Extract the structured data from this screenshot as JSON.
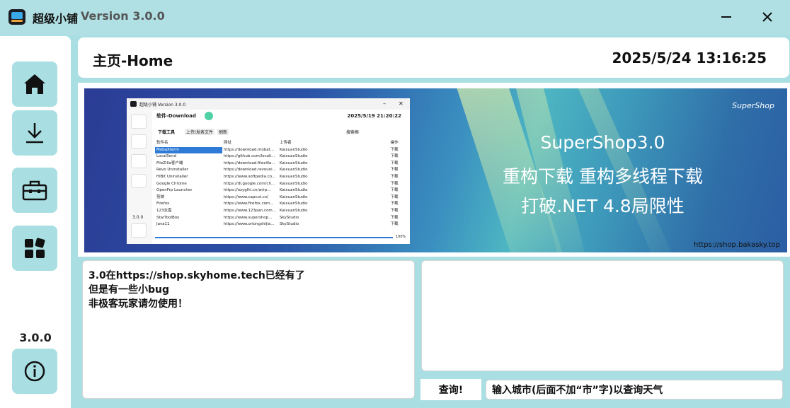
{
  "window": {
    "title": "超级小铺",
    "version": "Version 3.0.0"
  },
  "sidebar": {
    "items": [
      {
        "icon": "home-icon"
      },
      {
        "icon": "download-icon"
      },
      {
        "icon": "toolbox-icon"
      },
      {
        "icon": "apps-icon"
      }
    ],
    "version": "3.0.0",
    "about_icon": "info-icon"
  },
  "header": {
    "title": "主页-Home",
    "datetime": "2025/5/24 13:16:25"
  },
  "banner": {
    "logo": "SuperShop",
    "line1": "SuperShop3.0",
    "line2": "重构下载 重构多线程下载",
    "line3": "打破.NET 4.8局限性",
    "url": "https://shop.bakasky.top",
    "screenshot": {
      "title": "超级小铺 Version 3.0.0",
      "header": "软件-Download",
      "datetime": "2025/5/19 21:20:22",
      "toolbar": [
        "下载工具",
        "上传/发表文件",
        "刷新",
        "搜索框"
      ],
      "columns": [
        "软件名",
        "网址",
        "上传者",
        "操作"
      ],
      "rows": [
        [
          "MobaXterm",
          "https://download.mobat...",
          "KaixuanStudio",
          "下载"
        ],
        [
          "LocalSend",
          "https://github.com/locali...",
          "KaixuanStudio",
          "下载"
        ],
        [
          "FileZilla客户端",
          "https://download.filezilla...",
          "KaixuanStudio",
          "下载"
        ],
        [
          "Revo Uninstaller",
          "https://download.revouni...",
          "KaixuanStudio",
          "下载"
        ],
        [
          "HiBit Uninstaller",
          "https://www.softpedia.co...",
          "KaixuanStudio",
          "下载"
        ],
        [
          "Google Chrome",
          "https://dl.google.com/ch...",
          "KaixuanStudio",
          "下载"
        ],
        [
          "OpenFrp Launcher",
          "https://ozyglhi.cn/w/rp...",
          "KaixuanStudio",
          "下载"
        ],
        [
          "剪映",
          "https://www.capcut.cn/",
          "KaixuanStudio",
          "下载"
        ],
        [
          "Firefox",
          "https://www.firefox.com...",
          "KaixuanStudio",
          "下载"
        ],
        [
          "123云盘",
          "https://www.123pan.com...",
          "KaixuanStudio",
          "下载"
        ],
        [
          "StarToolBox",
          "https://www.supershop...",
          "SkyStudio",
          "下载"
        ],
        [
          "Java11",
          "https://www.oriongshijia...",
          "SkyStudio",
          "下载"
        ]
      ],
      "version": "3.0.0",
      "progress_label": "100%",
      "progress": 1.0
    }
  },
  "notice": {
    "line1": "3.0在https://shop.skyhome.tech已经有了",
    "line2": "但是有一些小bug",
    "line3": "非极客玩家请勿使用！"
  },
  "weather": {
    "query_label": "查询!",
    "city_value": "输入城市(后面不加“市”字)以查询天气"
  },
  "colors": {
    "accent": "#a9dfe3",
    "titlebar": "#b0e0e4",
    "card": "#ffffff"
  }
}
